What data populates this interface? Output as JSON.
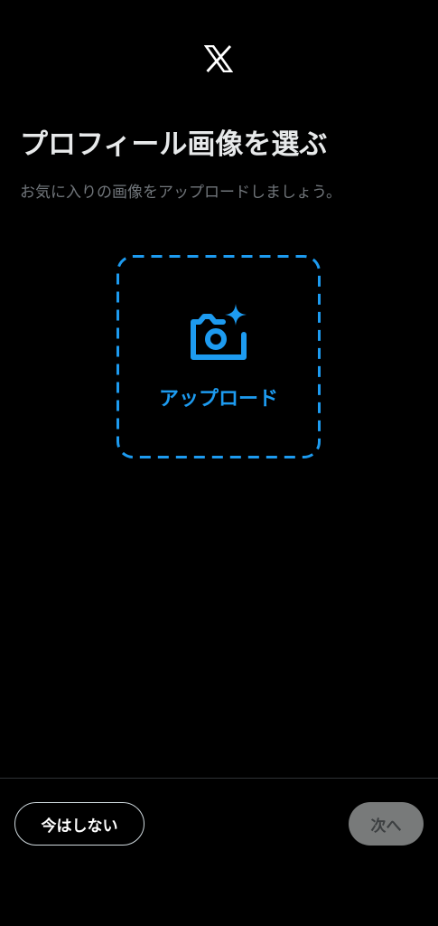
{
  "header": {
    "logo_icon": "x-logo-icon"
  },
  "main": {
    "title": "プロフィール画像を選ぶ",
    "subtitle": "お気に入りの画像をアップロードしましょう。",
    "upload": {
      "icon": "camera-sparkle-icon",
      "label": "アップロード",
      "accent_color": "#1d9bf0"
    }
  },
  "footer": {
    "skip_label": "今はしない",
    "next_label": "次へ",
    "next_disabled": true
  }
}
